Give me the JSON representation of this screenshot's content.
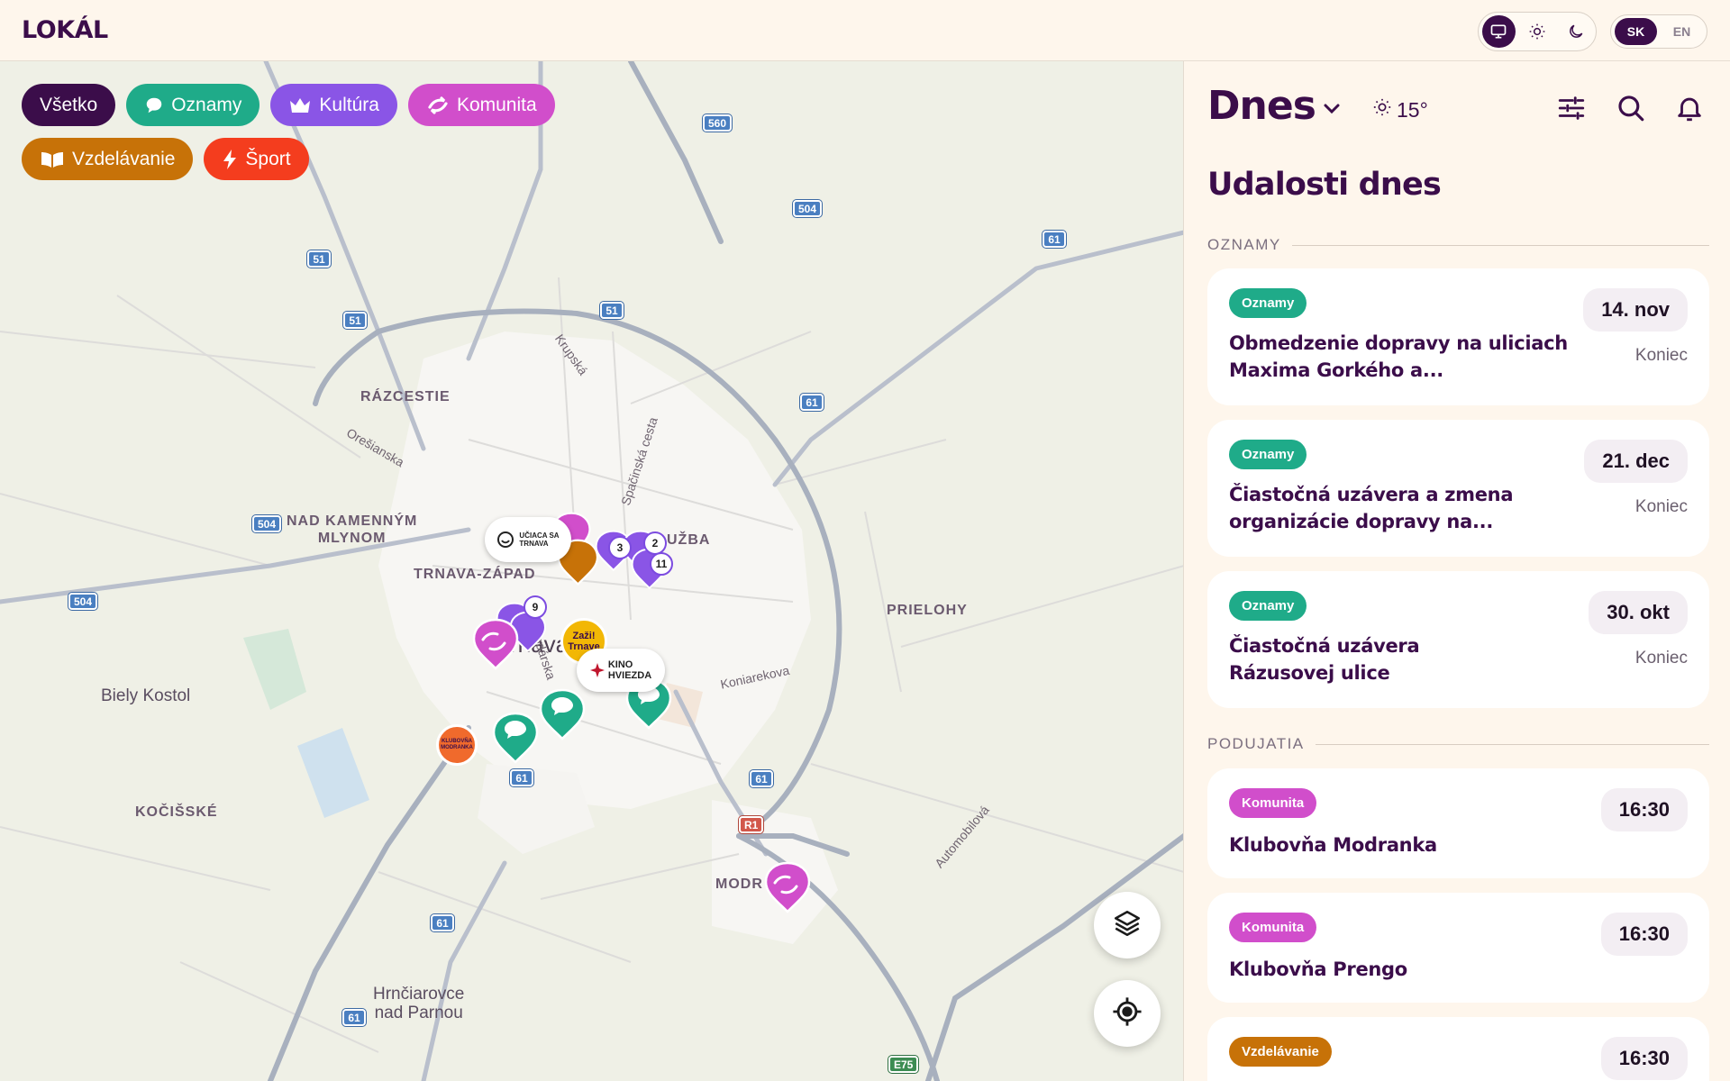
{
  "app": {
    "logo": "LOKÁL"
  },
  "header": {
    "theme_icons": [
      "monitor-icon",
      "sun-icon",
      "moon-icon"
    ],
    "languages": [
      {
        "label": "SK",
        "active": true
      },
      {
        "label": "EN",
        "active": false
      }
    ]
  },
  "colors": {
    "primary": "#3b0d4a",
    "oznamy": "#1fab89",
    "kultura": "#8a55e6",
    "komunita": "#d14ecb",
    "vzdelavanie": "#c77208",
    "sport": "#f43d1e"
  },
  "filters": [
    {
      "label": "Všetko",
      "icon": "",
      "color": "#3b0d4a"
    },
    {
      "label": "Oznamy",
      "icon": "speech-bubble-icon",
      "color": "#1fab89"
    },
    {
      "label": "Kultúra",
      "icon": "crown-icon",
      "color": "#8a55e6"
    },
    {
      "label": "Komunita",
      "icon": "link-arrows-icon",
      "color": "#d14ecb"
    },
    {
      "label": "Vzdelávanie",
      "icon": "open-book-icon",
      "color": "#c77208"
    },
    {
      "label": "Šport",
      "icon": "lightning-icon",
      "color": "#f43d1e"
    }
  ],
  "map": {
    "areas": {
      "razcestie": "RÁZCESTIE",
      "nad_kamennym_mlynom": "NAD KAMENNÝM\nMLYNOM",
      "trnava_zapad": "TRNAVA-ZÁPAD",
      "druzba": "UŽBA",
      "prielohy": "PRIELOHY",
      "kocisske": "KOČIŠSKÉ",
      "modranka": "MODR"
    },
    "places": {
      "biely_kostol": "Biely Kostol",
      "trnava": "rnava",
      "hrnciarovce": "Hrnčiarovce\nnad Parnou"
    },
    "streets": {
      "krupska": "Krupská",
      "spacinska": "Spačinská cesta",
      "oresianska": "Orešianska",
      "koniarekova": "Koniarekova",
      "automobilova": "Automobilová",
      "hospodarska": "spodárska"
    },
    "road_numbers": [
      "560",
      "504",
      "61",
      "51",
      "51",
      "51",
      "61",
      "504",
      "504",
      "61",
      "61",
      "R1",
      "61",
      "61",
      "E75"
    ],
    "cluster_counts": [
      "3",
      "2",
      "11",
      "9"
    ],
    "venues": {
      "uciaca": "UČIACA SA\nTRNAVA",
      "kino": "KINO\nHVIEZDA",
      "zazi": "Zaži!\nTrnave",
      "modranka_logo": "KLUBOVŇA\nMODRANKA"
    },
    "fab_icons": [
      "layers-icon",
      "locate-icon"
    ]
  },
  "sidebar": {
    "day": "Dnes",
    "weather": {
      "temp": "15°",
      "icon": "sun-icon"
    },
    "actions": [
      "filter-sliders-icon",
      "search-icon",
      "bell-icon"
    ],
    "heading": "Udalosti dnes",
    "groups": [
      {
        "label": "OZNAMY",
        "items": [
          {
            "tag": "Oznamy",
            "title": "Obmedzenie dopravy na uliciach Maxima Gorkého a...",
            "date": "14. nov",
            "sub": "Koniec"
          },
          {
            "tag": "Oznamy",
            "title": "Čiastočná uzávera a zmena organizácie dopravy na...",
            "date": "21. dec",
            "sub": "Koniec"
          },
          {
            "tag": "Oznamy",
            "title": "Čiastočná uzávera Rázusovej ulice",
            "date": "30. okt",
            "sub": "Koniec"
          }
        ]
      },
      {
        "label": "PODUJATIA",
        "items": [
          {
            "tag": "Komunita",
            "title": "Klubovňa Modranka",
            "date": "16:30"
          },
          {
            "tag": "Komunita",
            "title": "Klubovňa Prengo",
            "date": "16:30"
          },
          {
            "tag": "Vzdelávanie",
            "title": "",
            "date": "16:30"
          }
        ]
      }
    ]
  }
}
